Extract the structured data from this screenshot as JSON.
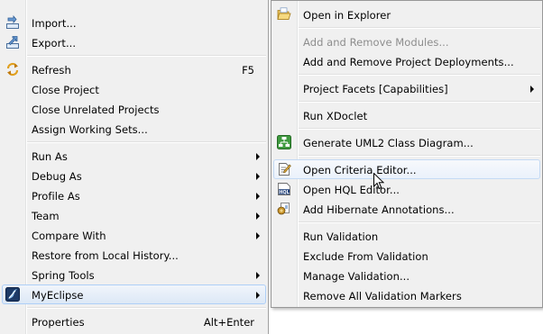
{
  "main_menu": {
    "import": "Import...",
    "export": "Export...",
    "refresh": "Refresh",
    "refresh_shortcut": "F5",
    "close_project": "Close Project",
    "close_unrelated": "Close Unrelated Projects",
    "assign_working_sets": "Assign Working Sets...",
    "run_as": "Run As",
    "debug_as": "Debug As",
    "profile_as": "Profile As",
    "team": "Team",
    "compare_with": "Compare With",
    "restore_history": "Restore from Local History...",
    "spring_tools": "Spring Tools",
    "myeclipse": "MyEclipse",
    "properties": "Properties",
    "properties_shortcut": "Alt+Enter"
  },
  "sub_menu": {
    "open_in_explorer": "Open in Explorer",
    "add_remove_modules": "Add and Remove Modules...",
    "add_remove_deployments": "Add and Remove Project Deployments...",
    "project_facets": "Project Facets [Capabilities]",
    "run_xdoclet": "Run XDoclet",
    "generate_uml2": "Generate UML2 Class Diagram...",
    "open_criteria_editor": "Open Criteria Editor...",
    "open_hql_editor": "Open HQL Editor...",
    "add_hibernate_annotations": "Add Hibernate Annotations...",
    "run_validation": "Run Validation",
    "exclude_from_validation": "Exclude From Validation",
    "manage_validation": "Manage Validation...",
    "remove_validation_markers": "Remove All Validation Markers"
  },
  "icons": {
    "import": "import-icon",
    "export": "export-icon",
    "refresh": "refresh-icon",
    "myeclipse": "myeclipse-icon",
    "open_in_explorer": "folder-icon",
    "generate_uml2": "uml-diagram-icon",
    "open_criteria_editor": "criteria-editor-icon",
    "open_hql_editor": "hql-editor-icon",
    "add_hibernate_annotations": "hibernate-annotation-icon"
  },
  "colors": {
    "menu_background": "#f0f0f0",
    "highlight_border": "#aecff7",
    "disabled_text": "#8d8d8d"
  }
}
